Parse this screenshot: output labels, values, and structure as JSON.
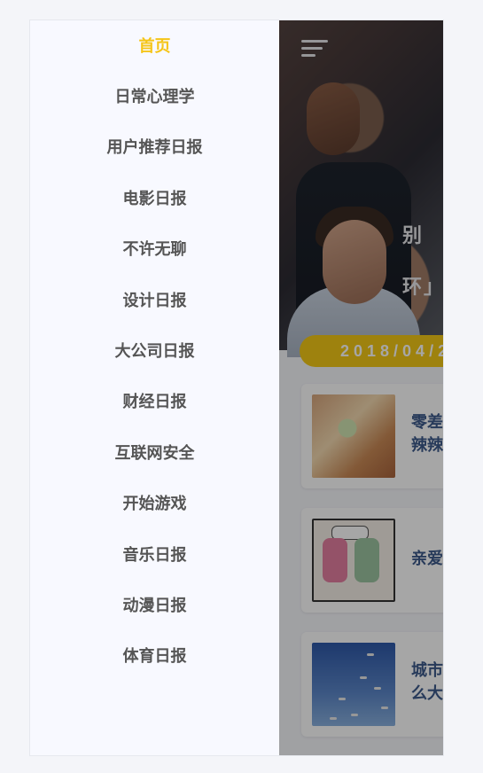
{
  "drawer": {
    "items": [
      {
        "label": "首页",
        "active": true
      },
      {
        "label": "日常心理学"
      },
      {
        "label": "用户推荐日报"
      },
      {
        "label": "电影日报"
      },
      {
        "label": "不许无聊"
      },
      {
        "label": "设计日报"
      },
      {
        "label": "大公司日报"
      },
      {
        "label": "财经日报"
      },
      {
        "label": "互联网安全"
      },
      {
        "label": "开始游戏"
      },
      {
        "label": "音乐日报"
      },
      {
        "label": "动漫日报"
      },
      {
        "label": "体育日报"
      }
    ]
  },
  "header": {
    "menu_icon": "menu-lines-icon"
  },
  "hero": {
    "title_line1": "别",
    "title_line2": "环」"
  },
  "date_pill": {
    "text": "2018/04/2"
  },
  "stories": [
    {
      "title": "零差\n辣辣"
    },
    {
      "title": "亲爱"
    },
    {
      "title": "城市\n么大"
    }
  ],
  "colors": {
    "accent": "#f5c518",
    "menu_text": "#555555",
    "story_title": "#3d5a8a"
  }
}
